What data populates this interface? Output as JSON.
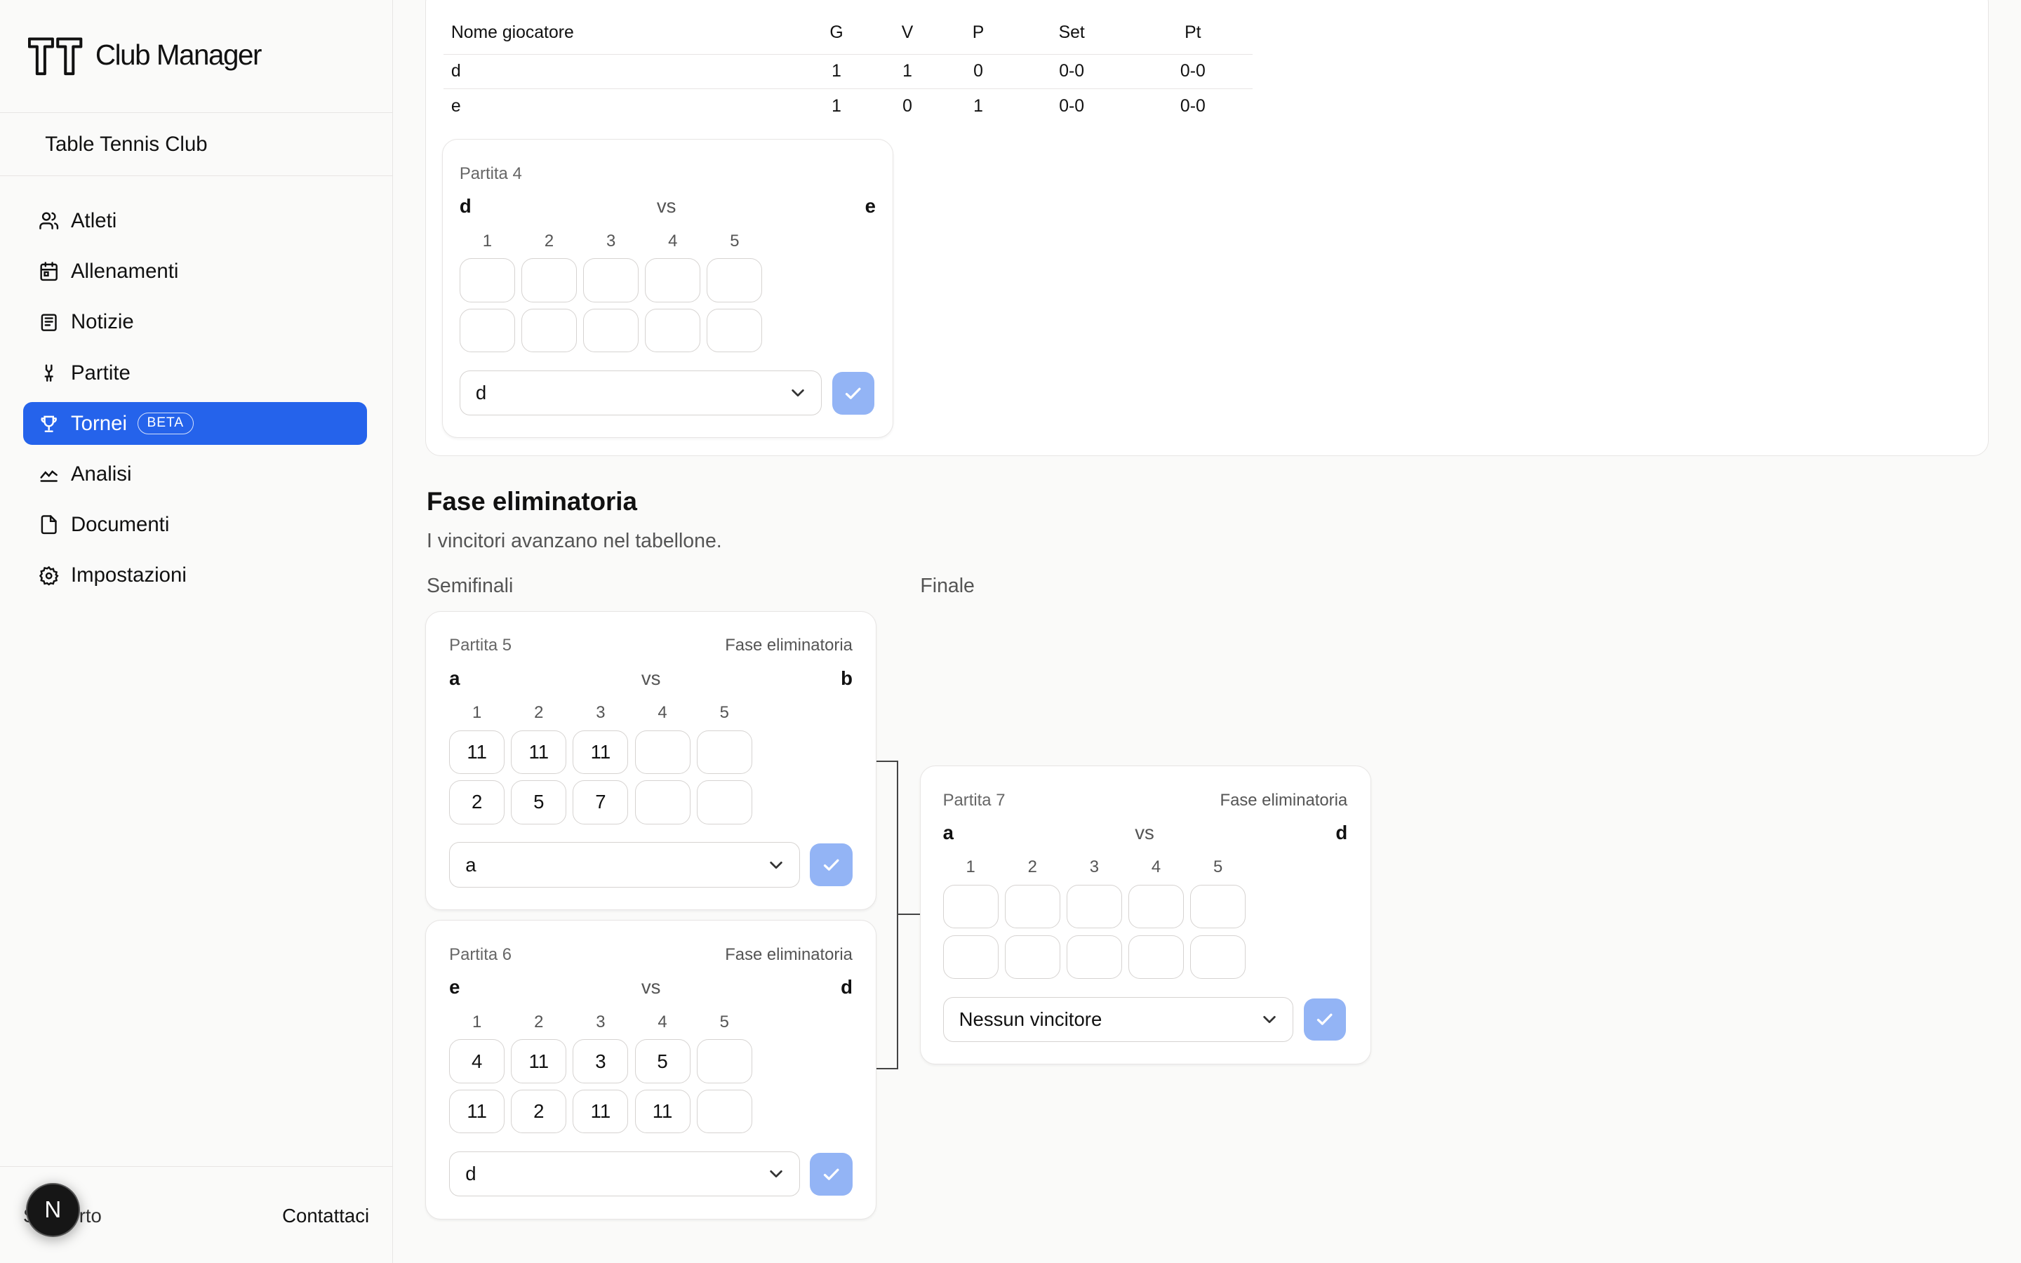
{
  "app": {
    "name": "Club Manager",
    "club_name": "Table Tennis Club"
  },
  "sidebar": {
    "items": [
      {
        "label": "Atleti",
        "icon": "users-icon"
      },
      {
        "label": "Allenamenti",
        "icon": "calendar-icon"
      },
      {
        "label": "Notizie",
        "icon": "newspaper-icon"
      },
      {
        "label": "Partite",
        "icon": "swords-icon"
      },
      {
        "label": "Tornei",
        "icon": "trophy-icon",
        "badge": "BETA",
        "active": true
      },
      {
        "label": "Analisi",
        "icon": "chart-line-icon"
      },
      {
        "label": "Documenti",
        "icon": "file-icon"
      },
      {
        "label": "Impostazioni",
        "icon": "gear-icon"
      }
    ],
    "footer": {
      "support": "Supporto",
      "contact": "Contattaci",
      "avatar_letter": "N"
    }
  },
  "standings": {
    "headers": [
      "Nome giocatore",
      "G",
      "V",
      "P",
      "Set",
      "Pt"
    ],
    "rows": [
      [
        "d",
        "1",
        "1",
        "0",
        "0-0",
        "0-0"
      ],
      [
        "e",
        "1",
        "0",
        "1",
        "0-0",
        "0-0"
      ]
    ]
  },
  "set_labels": [
    "1",
    "2",
    "3",
    "4",
    "5"
  ],
  "vs_label": "vs",
  "group_match": {
    "title": "Partita 4",
    "player1": "d",
    "player2": "e",
    "scores1": [
      "",
      "",
      "",
      "",
      ""
    ],
    "scores2": [
      "",
      "",
      "",
      "",
      ""
    ],
    "winner": "d"
  },
  "knockout": {
    "title": "Fase eliminatoria",
    "subtitle": "I vincitori avanzano nel tabellone.",
    "rounds": [
      "Semifinali",
      "Finale"
    ]
  },
  "bracket_matches": [
    {
      "title": "Partita 5",
      "phase": "Fase eliminatoria",
      "player1": "a",
      "player2": "b",
      "scores1": [
        "11",
        "11",
        "11",
        "",
        ""
      ],
      "scores2": [
        "2",
        "5",
        "7",
        "",
        ""
      ],
      "winner": "a"
    },
    {
      "title": "Partita 6",
      "phase": "Fase eliminatoria",
      "player1": "e",
      "player2": "d",
      "scores1": [
        "4",
        "11",
        "3",
        "5",
        ""
      ],
      "scores2": [
        "11",
        "2",
        "11",
        "11",
        ""
      ],
      "winner": "d"
    },
    {
      "title": "Partita 7",
      "phase": "Fase eliminatoria",
      "player1": "a",
      "player2": "d",
      "scores1": [
        "",
        "",
        "",
        "",
        ""
      ],
      "scores2": [
        "",
        "",
        "",
        "",
        ""
      ],
      "winner": "Nessun vincitore"
    }
  ],
  "colors": {
    "accent": "#2563eb",
    "confirm_disabled": "#93b4f5",
    "border": "#e7e5e4"
  }
}
